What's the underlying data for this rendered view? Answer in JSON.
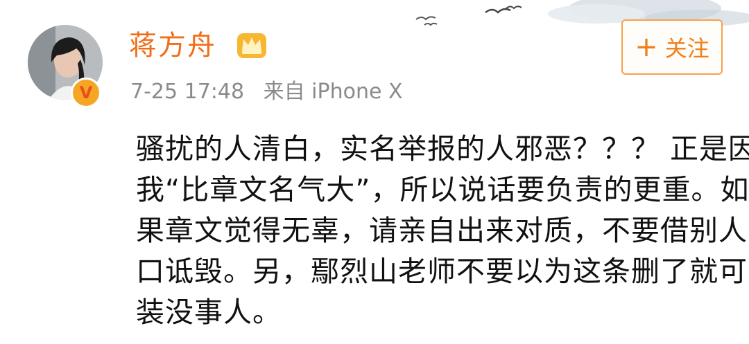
{
  "post": {
    "username": "蒋方舟",
    "timestamp": "7-25 17:48",
    "source": "来自 iPhone X",
    "follow_label": "关注",
    "follow_icon": "+",
    "verified_mark": "V",
    "verified_color": "#f5a623",
    "username_color": "#f26d18",
    "body_lines": [
      "骚扰的人清白，实名举报的人邪恶？？？ 正是因为",
      "我“比章文名气大”，所以说话要负责的更重。如",
      "果章文觉得无辜，请亲自出来对质，不要借别人的",
      "口诋毁。另，鄢烈山老师不要以为这条删了就可以",
      "装没事人。"
    ]
  }
}
